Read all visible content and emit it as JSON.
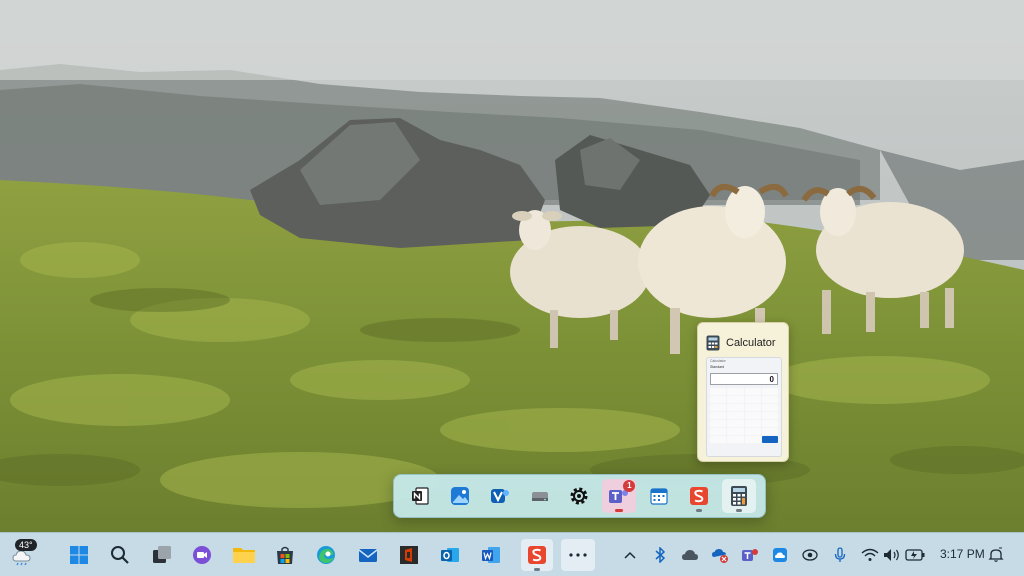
{
  "desktop": {
    "wallpaper": "foggy-hillside-with-sheep"
  },
  "overflow_flyout": {
    "items": [
      {
        "name": "onenote",
        "icon": "onenote-icon"
      },
      {
        "name": "photos",
        "icon": "photos-icon"
      },
      {
        "name": "viva",
        "icon": "viva-icon"
      },
      {
        "name": "drive",
        "icon": "drive-icon"
      },
      {
        "name": "settings",
        "icon": "gear-icon"
      },
      {
        "name": "teams",
        "icon": "teams-icon",
        "badge": "1"
      },
      {
        "name": "calendar",
        "icon": "calendar-icon"
      },
      {
        "name": "snagit",
        "icon": "snagit-icon"
      },
      {
        "name": "calculator",
        "icon": "calculator-icon"
      }
    ]
  },
  "calculator_preview": {
    "title": "Calculator",
    "window_title": "Calculator",
    "mode": "Standard",
    "display": "0"
  },
  "taskbar": {
    "weather_temp": "43°",
    "apps": [
      "widgets",
      "start",
      "search",
      "task-view",
      "meet",
      "file-explorer",
      "store",
      "edge",
      "mail",
      "office",
      "outlook",
      "word",
      "snagit",
      "more"
    ]
  },
  "system_tray": {
    "time": "3:17 PM"
  },
  "colors": {
    "taskbar_bg": "#c6dbe6",
    "flyout_bg": "#c8ecf0",
    "preview_bg": "#f6f2d9",
    "accent": "#1565c0",
    "badge_red": "#d43b3b"
  }
}
